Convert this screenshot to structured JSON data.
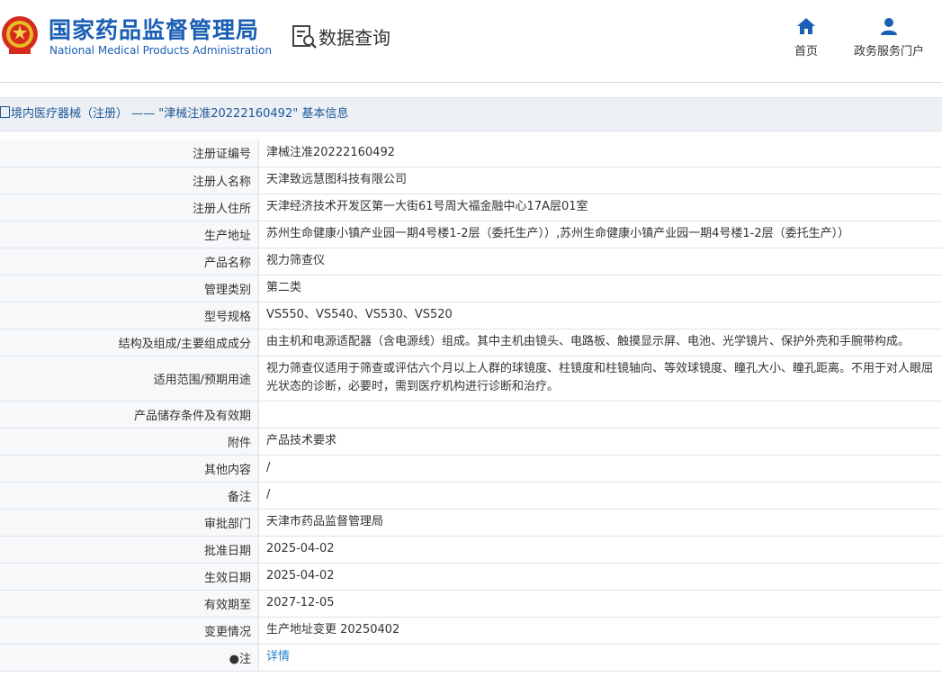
{
  "header": {
    "logo_cn": "国家药品监督管理局",
    "logo_en": "National Medical Products Administration",
    "query_title": "数据查询",
    "nav": [
      {
        "label": "首页",
        "icon": "home-icon"
      },
      {
        "label": "政务服务门户",
        "icon": "user-icon"
      }
    ]
  },
  "breadcrumb": "境内医疗器械（注册） —— \"津械注准20222160492\" 基本信息",
  "colors": {
    "brand": "#1a5fb4",
    "link": "#1e7fc8",
    "label_bg": "#f7f8fa",
    "border": "#dde3ea"
  },
  "rows": [
    {
      "label": "注册证编号",
      "value": "津械注准20222160492"
    },
    {
      "label": "注册人名称",
      "value": "天津致远慧图科技有限公司"
    },
    {
      "label": "注册人住所",
      "value": "天津经济技术开发区第一大街61号周大福金融中心17A层01室"
    },
    {
      "label": "生产地址",
      "value": "苏州生命健康小镇产业园一期4号楼1-2层（委托生产））,苏州生命健康小镇产业园一期4号楼1-2层（委托生产））"
    },
    {
      "label": "产品名称",
      "value": "视力筛查仪"
    },
    {
      "label": "管理类别",
      "value": "第二类"
    },
    {
      "label": "型号规格",
      "value": "VS550、VS540、VS530、VS520"
    },
    {
      "label": "结构及组成/主要组成成分",
      "value": "由主机和电源适配器（含电源线）组成。其中主机由镜头、电路板、触摸显示屏、电池、光学镜片、保护外壳和手腕带构成。"
    },
    {
      "label": "适用范围/预期用途",
      "value": "视力筛查仪适用于筛查或评估六个月以上人群的球镜度、柱镜度和柱镜轴向、等效球镜度、瞳孔大小、瞳孔距离。不用于对人眼屈光状态的诊断，必要时，需到医疗机构进行诊断和治疗。"
    },
    {
      "label": "产品储存条件及有效期",
      "value": ""
    },
    {
      "label": "附件",
      "value": "产品技术要求"
    },
    {
      "label": "其他内容",
      "value": "/"
    },
    {
      "label": "备注",
      "value": "/"
    },
    {
      "label": "审批部门",
      "value": "天津市药品监督管理局"
    },
    {
      "label": "批准日期",
      "value": "2025-04-02"
    },
    {
      "label": "生效日期",
      "value": "2025-04-02"
    },
    {
      "label": "有效期至",
      "value": "2027-12-05"
    },
    {
      "label": "变更情况",
      "value": "生产地址变更 20250402"
    },
    {
      "label": "●注",
      "value": "详情"
    }
  ]
}
